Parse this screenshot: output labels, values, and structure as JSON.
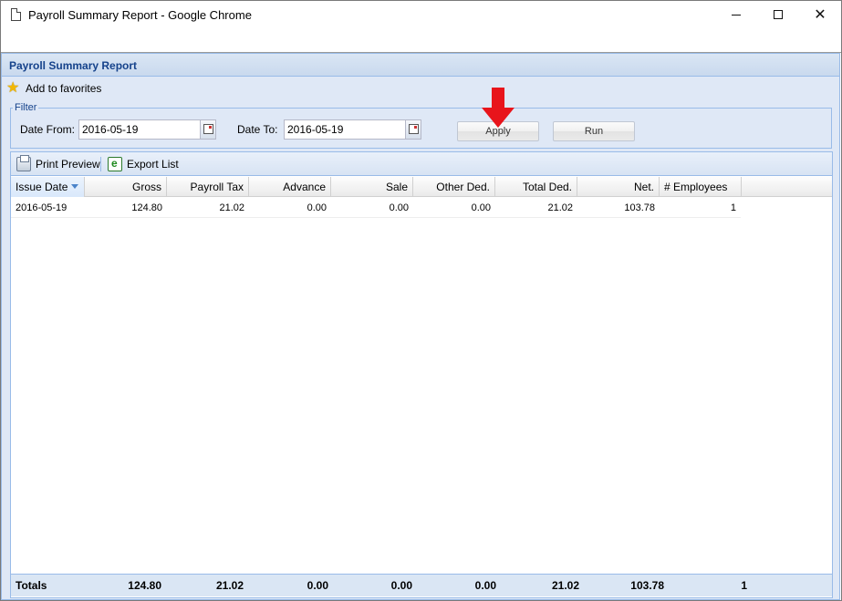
{
  "browser": {
    "title": "Payroll Summary Report - Google Chrome"
  },
  "panel": {
    "title": "Payroll Summary Report",
    "favorites_label": "Add to favorites"
  },
  "filter": {
    "legend": "Filter",
    "date_from_label": "Date From:",
    "date_from_value": "2016-05-19",
    "date_to_label": "Date To:",
    "date_to_value": "2016-05-19",
    "apply_label": "Apply",
    "run_label": "Run"
  },
  "toolbar": {
    "print_label": "Print Preview",
    "export_label": "Export List"
  },
  "table": {
    "columns": [
      "Issue Date",
      "Gross",
      "Payroll Tax",
      "Advance",
      "Sale",
      "Other Ded.",
      "Total Ded.",
      "Net.",
      "# Employees"
    ],
    "sort_column": "Issue Date",
    "rows": [
      [
        "2016-05-19",
        "124.80",
        "21.02",
        "0.00",
        "0.00",
        "0.00",
        "21.02",
        "103.78",
        "1"
      ]
    ],
    "totals": [
      "Totals",
      "124.80",
      "21.02",
      "0.00",
      "0.00",
      "0.00",
      "21.02",
      "103.78",
      "1"
    ]
  },
  "colors": {
    "accent": "#15428b",
    "panel_bg": "#dfe8f6",
    "border": "#99bbe8",
    "arrow": "#e8141b"
  }
}
